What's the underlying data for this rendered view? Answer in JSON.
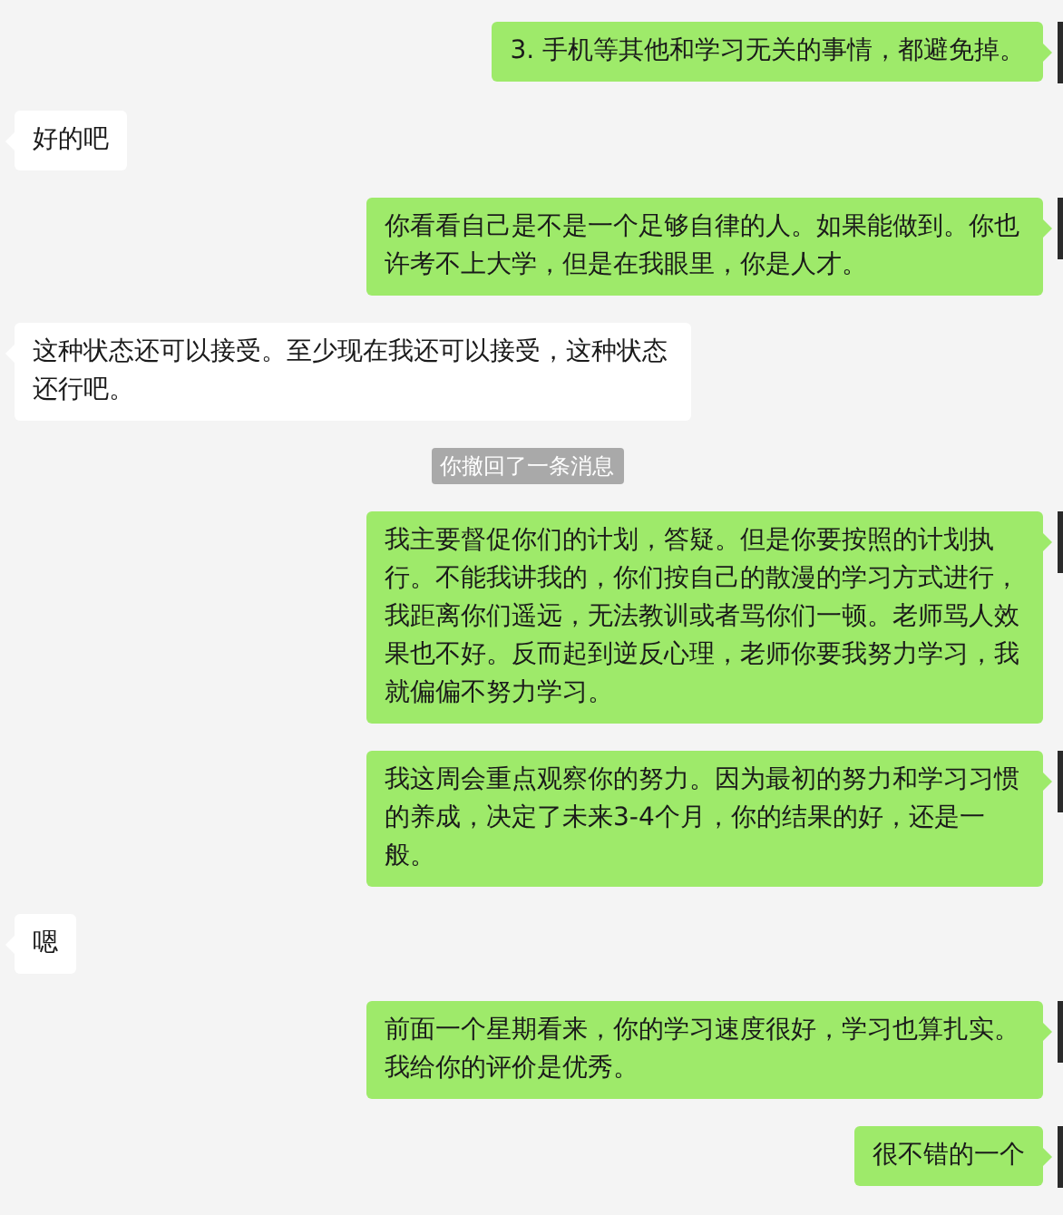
{
  "messages": [
    {
      "kind": "outgoing",
      "text": "3. 手机等其他和学习无关的事情，都避免掉。"
    },
    {
      "kind": "incoming",
      "text": "好的吧"
    },
    {
      "kind": "outgoing",
      "text": "你看看自己是不是一个足够自律的人。如果能做到。你也许考不上大学，但是在我眼里，你是人才。"
    },
    {
      "kind": "incoming",
      "text": "这种状态还可以接受。至少现在我还可以接受，这种状态还行吧。"
    },
    {
      "kind": "system",
      "text": "你撤回了一条消息"
    },
    {
      "kind": "outgoing",
      "text": "我主要督促你们的计划，答疑。但是你要按照的计划执行。不能我讲我的，你们按自己的散漫的学习方式进行，我距离你们遥远，无法教训或者骂你们一顿。老师骂人效果也不好。反而起到逆反心理，老师你要我努力学习，我就偏偏不努力学习。"
    },
    {
      "kind": "outgoing",
      "text": "我这周会重点观察你的努力。因为最初的努力和学习习惯的养成，决定了未来3-4个月，你的结果的好，还是一般。"
    },
    {
      "kind": "incoming",
      "text": "嗯"
    },
    {
      "kind": "outgoing",
      "text": "前面一个星期看来，你的学习速度很好，学习也算扎实。我给你的评价是优秀。"
    },
    {
      "kind": "outgoing",
      "text": "很不错的一个"
    }
  ]
}
